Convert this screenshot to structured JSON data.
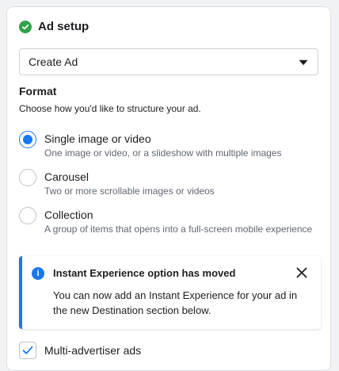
{
  "section": {
    "title": "Ad setup",
    "status_icon": "check-circle-icon",
    "status_color": "#31a24c"
  },
  "ad_select": {
    "value": "Create Ad",
    "icon": "caret-down-icon"
  },
  "format": {
    "title": "Format",
    "description": "Choose how you'd like to structure your ad.",
    "options": [
      {
        "label": "Single image or video",
        "description": "One image or video, or a slideshow with multiple images",
        "selected": true
      },
      {
        "label": "Carousel",
        "description": "Two or more scrollable images or videos",
        "selected": false
      },
      {
        "label": "Collection",
        "description": "A group of items that opens into a full-screen mobile experience",
        "selected": false
      }
    ]
  },
  "notice": {
    "icon": "info-icon",
    "title": "Instant Experience option has moved",
    "body": "You can now add an Instant Experience for your ad in the new Destination section below.",
    "close_icon": "close-icon",
    "accent_color": "#1877f2"
  },
  "multi_advertiser": {
    "label": "Multi-advertiser ads",
    "checked": true
  },
  "colors": {
    "accent": "#1877f2",
    "success": "#31a24c"
  }
}
